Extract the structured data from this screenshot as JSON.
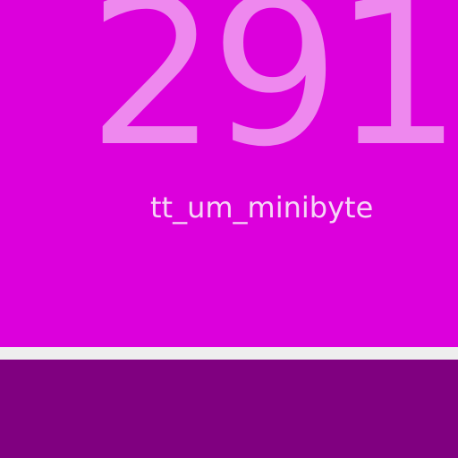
{
  "display": {
    "value": "291",
    "unit": "tt_um_minibyte"
  },
  "colors": {
    "panel_background": "#dc00dc",
    "value_text": "#ee88ee",
    "unit_text": "#f6d6f6",
    "divider": "#eeeeee",
    "bottom_background": "#800080"
  }
}
